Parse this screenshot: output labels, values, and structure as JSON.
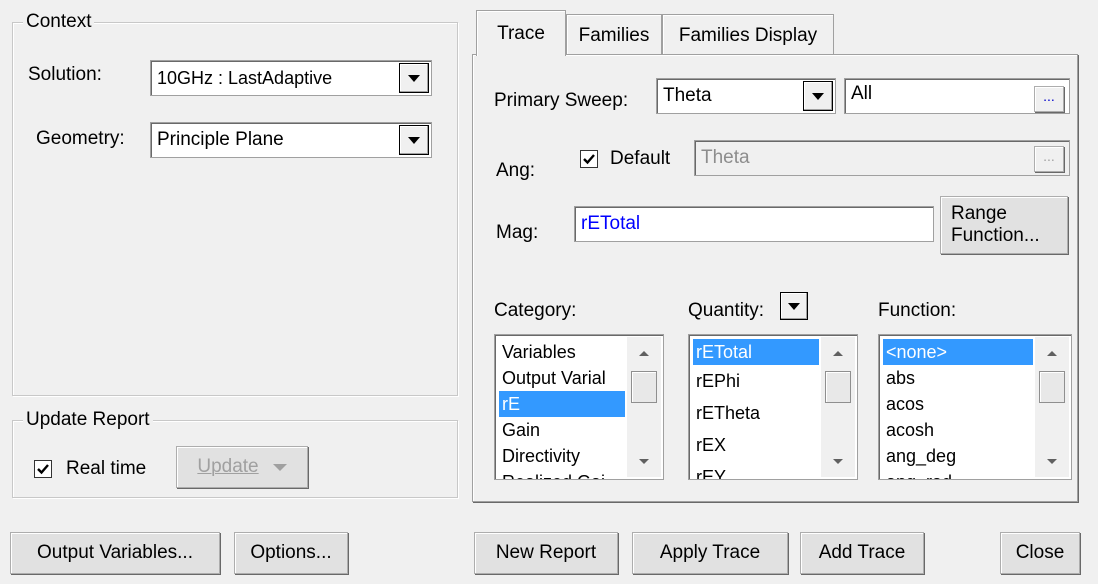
{
  "context": {
    "title": "Context",
    "solution_label": "Solution:",
    "solution_value": "10GHz : LastAdaptive",
    "geometry_label": "Geometry:",
    "geometry_value": "Principle Plane"
  },
  "update_report": {
    "title": "Update Report",
    "realtime_label": "Real time",
    "realtime_checked": true,
    "update_button": "Update"
  },
  "tabs": [
    {
      "label": "Trace",
      "active": true
    },
    {
      "label": "Families",
      "active": false
    },
    {
      "label": "Families Display",
      "active": false
    }
  ],
  "trace": {
    "primary_sweep_label": "Primary Sweep:",
    "primary_sweep_value": "Theta",
    "sweep_range_value": "All",
    "sweep_ellipsis": "...",
    "ang_label": "Ang:",
    "default_label": "Default",
    "default_checked": true,
    "ang_value": "Theta",
    "ang_ellipsis": "...",
    "mag_label": "Mag:",
    "mag_value": "rETotal",
    "mag_value_color": "#0000ff",
    "range_function_line1": "Range",
    "range_function_line2": "Function...",
    "category_label": "Category:",
    "quantity_label": "Quantity:",
    "function_label": "Function:",
    "category_items": [
      "Variables",
      "Output Varial",
      "rE",
      "Gain",
      "Directivity",
      "Realized Gai"
    ],
    "category_selected": 2,
    "quantity_items": [
      "rETotal",
      "rEPhi",
      "rETheta",
      "rEX",
      "rEY"
    ],
    "quantity_selected": 0,
    "function_items": [
      "<none>",
      "abs",
      "acos",
      "acosh",
      "ang_deg",
      "ang_rad"
    ],
    "function_selected": 0,
    "selection_color": "#3399ff"
  },
  "bottom_buttons": {
    "output_variables": "Output Variables...",
    "options": "Options...",
    "new_report": "New Report",
    "apply_trace": "Apply Trace",
    "add_trace": "Add Trace",
    "close": "Close"
  }
}
